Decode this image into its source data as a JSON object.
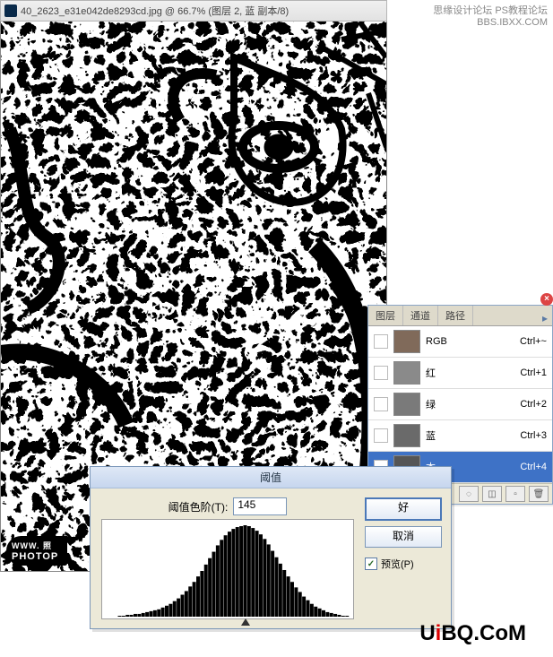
{
  "wallpaper": {
    "line1": "思缘设计论坛  PS教程论坛",
    "line2": "BBS.IBXX.COM"
  },
  "document": {
    "title": "40_2623_e31e042de8293cd.jpg @ 66.7% (图层 2, 蓝 副本/8)"
  },
  "watermark_bottom": {
    "line1": "WWW.   照",
    "line2": "PHOTOP"
  },
  "panel": {
    "tabs": [
      "图层",
      "通道",
      "路径"
    ],
    "channels": [
      {
        "label": "RGB",
        "shortcut": "Ctrl+~",
        "selected": false,
        "thumb": "#806a5a"
      },
      {
        "label": "红",
        "shortcut": "Ctrl+1",
        "selected": false,
        "thumb": "#8a8a8a"
      },
      {
        "label": "绿",
        "shortcut": "Ctrl+2",
        "selected": false,
        "thumb": "#7a7a7a"
      },
      {
        "label": "蓝",
        "shortcut": "Ctrl+3",
        "selected": false,
        "thumb": "#6a6a6a"
      },
      {
        "label": "本",
        "shortcut": "Ctrl+4",
        "selected": true,
        "thumb": "#555555"
      }
    ]
  },
  "dialog": {
    "title": "阈值",
    "threshold_label": "阈值色阶(T):",
    "threshold_value": "145",
    "ok": "好",
    "cancel": "取消",
    "preview": "预览(P)",
    "histogram": {
      "bins": 64,
      "values": [
        0,
        0,
        0,
        0,
        1,
        1,
        2,
        2,
        3,
        3,
        4,
        5,
        6,
        7,
        8,
        10,
        12,
        14,
        17,
        20,
        24,
        28,
        33,
        38,
        44,
        50,
        57,
        64,
        71,
        78,
        84,
        89,
        93,
        96,
        98,
        99,
        100,
        99,
        97,
        94,
        90,
        85,
        79,
        72,
        65,
        58,
        51,
        44,
        38,
        32,
        27,
        22,
        18,
        14,
        11,
        9,
        7,
        5,
        4,
        3,
        2,
        1,
        1,
        0
      ],
      "max": 100,
      "slider_pos_frac": 0.57
    }
  },
  "brand": {
    "prefix": "U",
    "accent": "i",
    "suffix": "BQ.CoM"
  }
}
